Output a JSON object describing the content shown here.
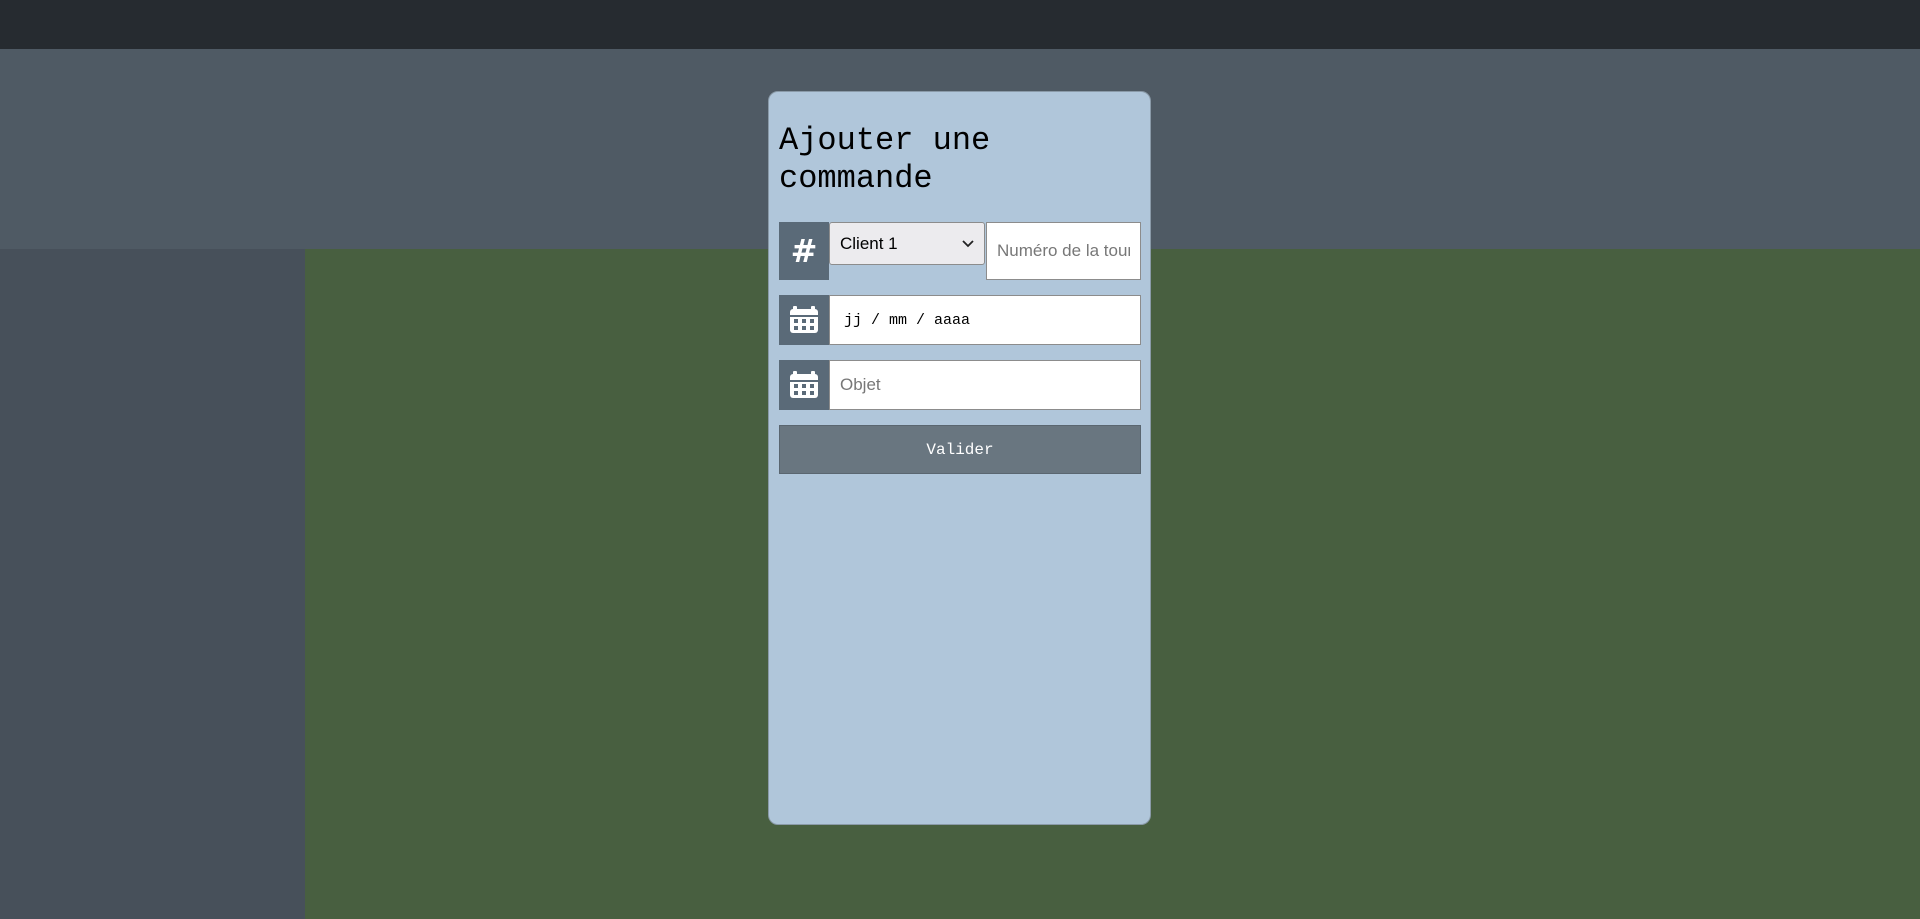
{
  "form": {
    "title": "Ajouter une commande",
    "client_select": {
      "selected": "Client 1",
      "icon": "hash-icon"
    },
    "tour_input": {
      "placeholder": "Numéro de la tournée"
    },
    "date_input": {
      "format_text": "jj / mm / aaaa",
      "icon": "calendar-icon"
    },
    "objet_input": {
      "placeholder": "Objet",
      "icon": "calendar-icon"
    },
    "submit_label": "Valider"
  },
  "colors": {
    "topbar": "#262b30",
    "header_band": "#4f5a64",
    "sidebar": "#47505a",
    "main": "#485f40",
    "card": "#b0c6da",
    "icon_box": "#5a6a78",
    "button": "#697680"
  }
}
